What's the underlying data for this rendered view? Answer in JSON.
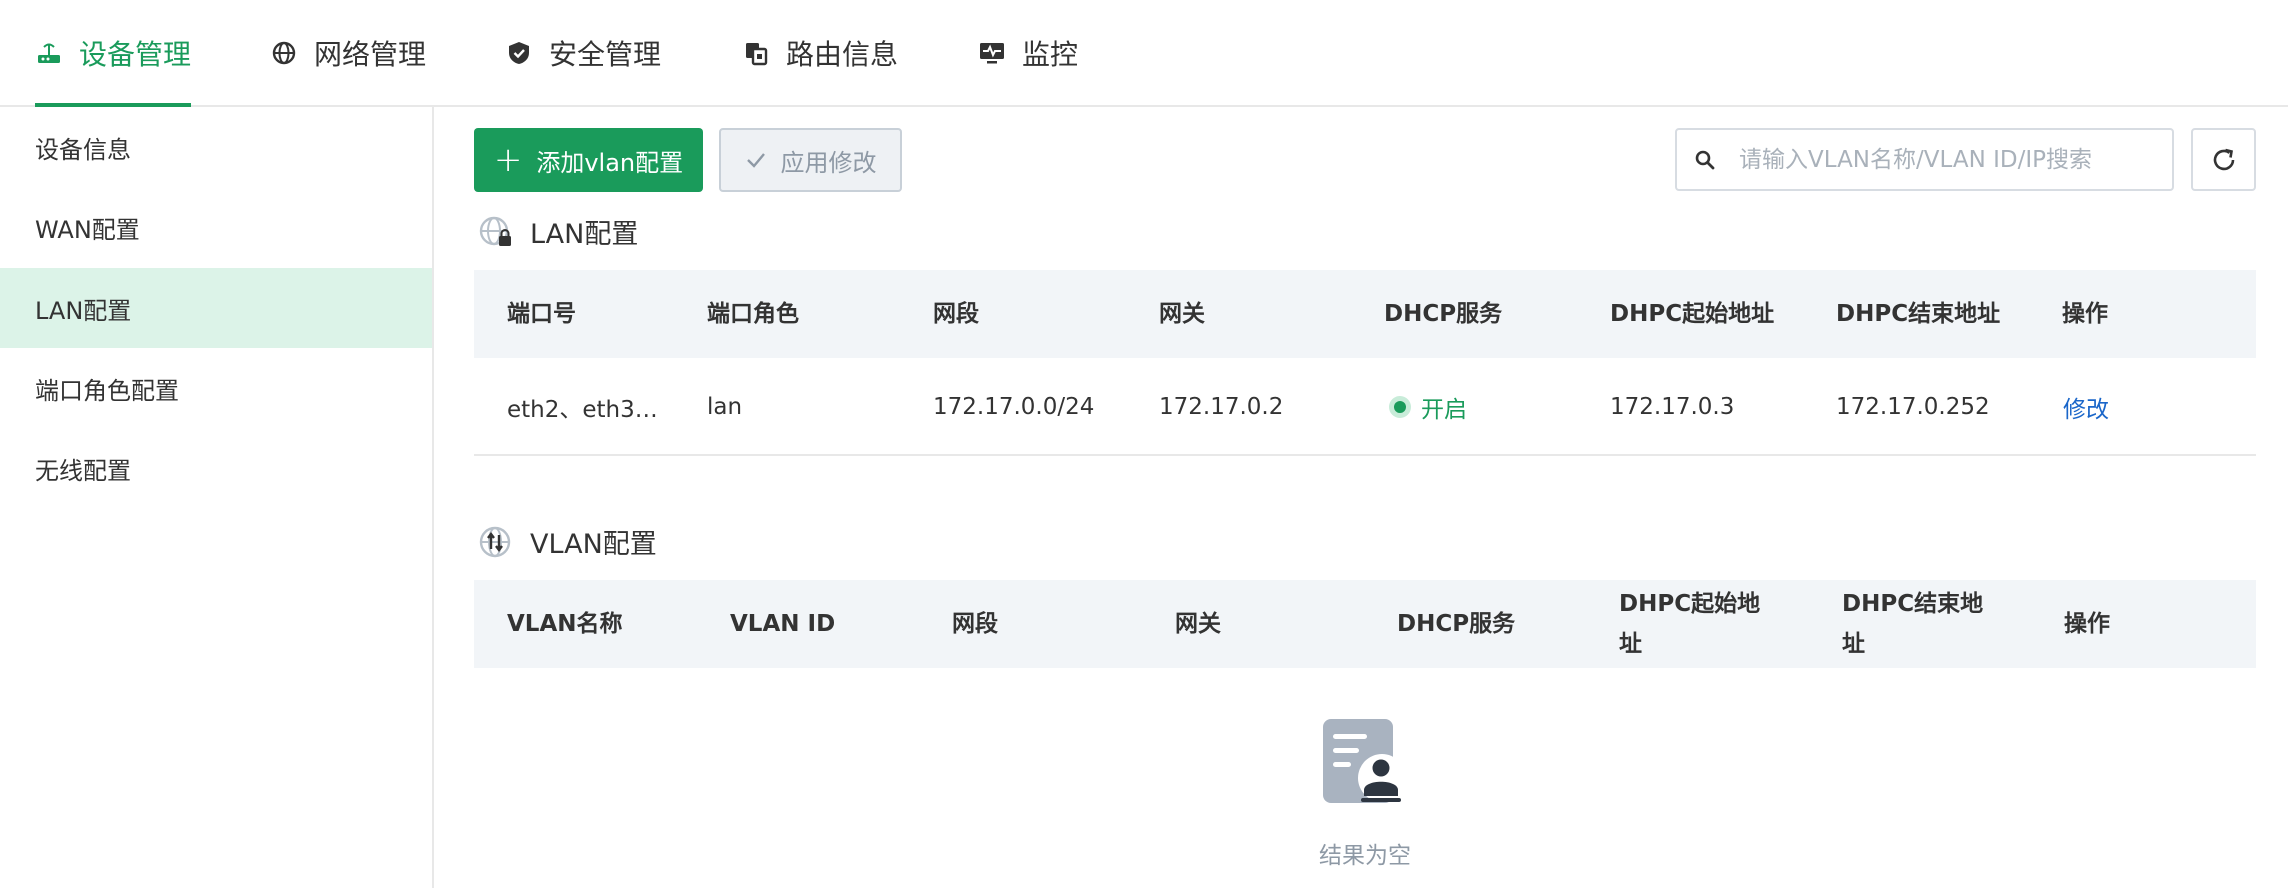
{
  "topnav": {
    "items": [
      {
        "label": "设备管理",
        "icon": "router-icon",
        "active": true
      },
      {
        "label": "网络管理",
        "icon": "globe-icon",
        "active": false
      },
      {
        "label": "安全管理",
        "icon": "shield-icon",
        "active": false
      },
      {
        "label": "路由信息",
        "icon": "route-icon",
        "active": false
      },
      {
        "label": "监控",
        "icon": "monitor-icon",
        "active": false
      }
    ],
    "accent_color": "#1a9b5b"
  },
  "sidebar": {
    "items": [
      {
        "label": "设备信息",
        "active": false
      },
      {
        "label": "WAN配置",
        "active": false
      },
      {
        "label": "LAN配置",
        "active": true
      },
      {
        "label": "端口角色配置",
        "active": false
      },
      {
        "label": "无线配置",
        "active": false
      }
    ]
  },
  "toolbar": {
    "add_label": "添加vlan配置",
    "apply_label": "应用修改",
    "search_placeholder": "请输入VLAN名称/VLAN ID/IP搜索",
    "search_value": ""
  },
  "lan": {
    "title": "LAN配置",
    "columns": [
      "端口号",
      "端口角色",
      "网段",
      "网关",
      "DHCP服务",
      "DHPC起始地址",
      "DHPC结束地址",
      "操作"
    ],
    "rows": [
      {
        "port": "eth2、eth3…",
        "role": "lan",
        "subnet": "172.17.0.0/24",
        "gateway": "172.17.0.2",
        "dhcp": "开启",
        "dhcp_start": "172.17.0.3",
        "dhcp_end": "172.17.0.252",
        "action": "修改"
      }
    ],
    "status_color": "#1a9b5b",
    "link_color": "#1a66c9"
  },
  "vlan": {
    "title": "VLAN配置",
    "columns": [
      "VLAN名称",
      "VLAN ID",
      "网段",
      "网关",
      "DHCP服务",
      "DHPC起始地址",
      "DHPC结束地址",
      "操作"
    ],
    "rows": [],
    "empty_text": "结果为空"
  }
}
